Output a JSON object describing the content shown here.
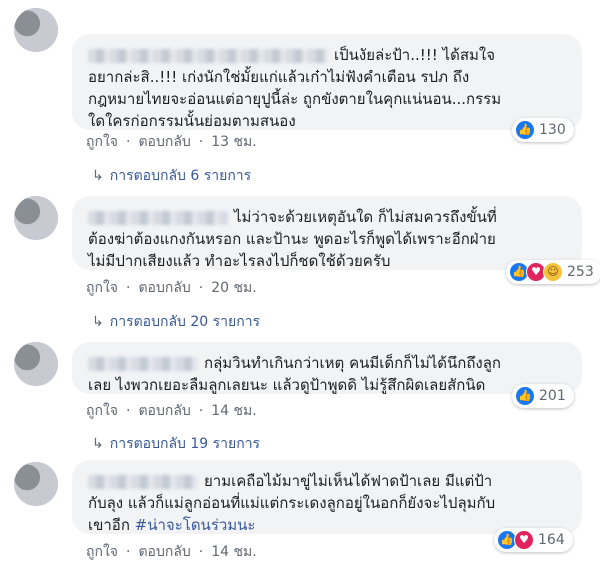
{
  "comments": [
    {
      "text": "เป็นงัยล่ะป้า..!!! ได้สมใจอยากล่ะสิ..!!! เก่งนักใช่มั้ยแก่แล้วเก๋าไม่ฟังคำเตือน รปภ ถึงกฎหมายไทยจะอ่อนแต่อายุปูนี้ล่ะ ถูกขังตายในคุกแน่นอน...กรรมใดใครก่อกรรมนั้นย่อมตามสนอง",
      "lines": [
        "เป็นงัยล่ะป้า..!!! ได้สมใจ",
        "อยากล่ะสิ..!!! เก่งนักใช่มั้ยแก่แล้วเก๋าไม่ฟังคำเตือน รปภ ถึง",
        "กฎหมายไทยจะอ่อนแต่อายุปูนี้ล่ะ ถูกขังตายในคุกแน่นอน...กรรม",
        "ใดใครก่อกรรมนั้นย่อมตามสนอง"
      ],
      "like_label": "ถูกใจ",
      "reply_label": "ตอบกลับ",
      "time": "13 ชม.",
      "reaction_count": "130",
      "replies_link": "การตอบกลับ 6 รายการ"
    },
    {
      "lines": [
        "ไม่ว่าจะด้วยเหตุอันใด ก็ไม่สมควรถึงขั้นที่",
        "ต้องฆ่าต้องแกงกันหรอก และป้านะ พูดอะไรก็พูดได้เพราะอีกฝ่าย",
        "ไม่มีปากเสียงแล้ว ทำอะไรลงไปก็ชดใช้ด้วยครับ"
      ],
      "like_label": "ถูกใจ",
      "reply_label": "ตอบกลับ",
      "time": "20 ชม.",
      "reaction_count": "253",
      "replies_link": "การตอบกลับ 20 รายการ"
    },
    {
      "lines": [
        "กลุ่มวินทำเกินกว่าเหตุ คนมีเด็กก็ไม่ได้นึกถึงลูก",
        "เลย ไงพวกเยอะลืมลูกเลยนะ แล้วดูป้าพูดดิ ไม่รู้สึกผิดเลยสักนิด"
      ],
      "like_label": "ถูกใจ",
      "reply_label": "ตอบกลับ",
      "time": "14 ชม.",
      "reaction_count": "201",
      "replies_link": "การตอบกลับ 19 รายการ"
    },
    {
      "lines": [
        "ยามเคถือไม้มาขู่ไม่เห็นได้ฟาดป้าเลย มีแต่ป้า",
        "กับลุง แล้วก็แม่ลูกอ่อนที่แม่แต่กระเดงลูกอยู่ในอกก็ยังจะไปลุมกับ",
        "เขาอีก "
      ],
      "hashtag": "#น่าจะโดนร่วมนะ",
      "like_label": "ถูกใจ",
      "reply_label": "ตอบกลับ",
      "time": "14 ชม.",
      "reaction_count": "164"
    }
  ],
  "icons": {
    "like": "thumbs-up-icon",
    "haha": "haha-icon",
    "love": "love-icon"
  },
  "colors": {
    "link": "#385898",
    "bubble": "#f2f3f5",
    "like_blue": "#1877f2"
  }
}
